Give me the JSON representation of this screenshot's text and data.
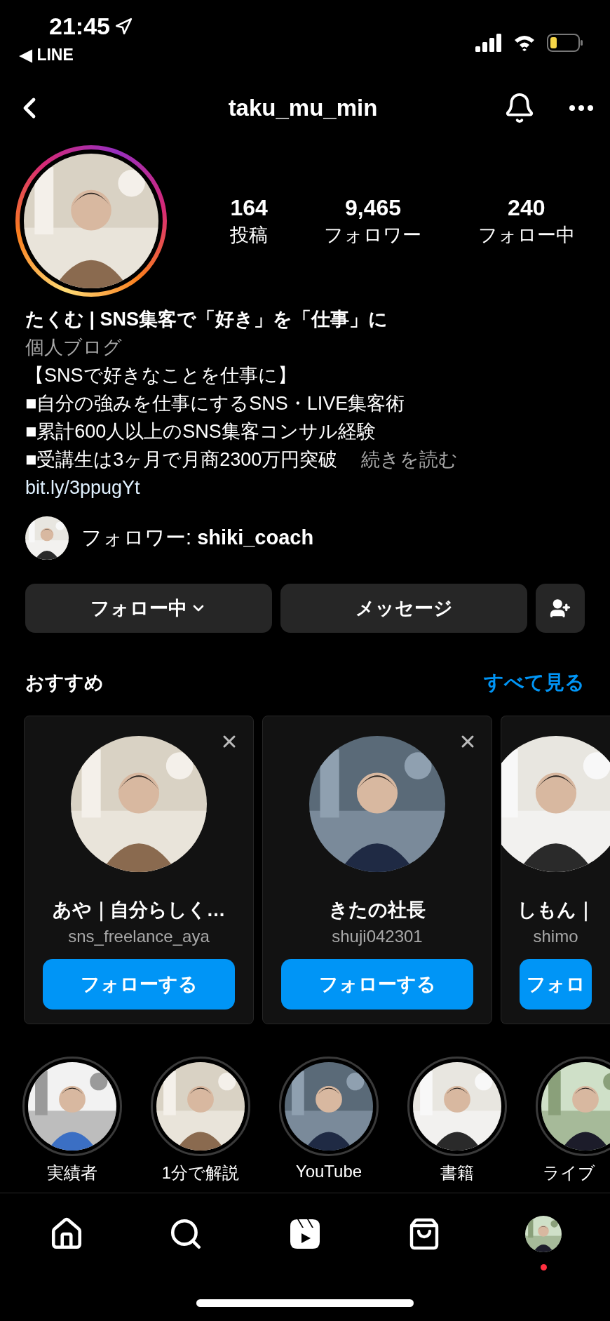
{
  "status_bar": {
    "time": "21:45",
    "back_app": "◀ LINE"
  },
  "header": {
    "username": "taku_mu_min"
  },
  "stats": [
    {
      "value": "164",
      "label": "投稿"
    },
    {
      "value": "9,465",
      "label": "フォロワー"
    },
    {
      "value": "240",
      "label": "フォロー中"
    }
  ],
  "bio": {
    "name": "たくむ | SNS集客で「好き」を「仕事」に",
    "category": "個人ブログ",
    "lines": [
      "【SNSで好きなことを仕事に】",
      "■自分の強みを仕事にするSNS・LIVE集客術",
      "■累計600人以上のSNS集客コンサル経験",
      "■受講生は3ヶ月で月商2300万円突破"
    ],
    "more": "続きを読む",
    "link": "bit.ly/3ppugYt"
  },
  "followed_by": "フォロワー: **shiki_coach**",
  "actions": {
    "following": "フォロー中",
    "message": "メッセージ"
  },
  "suggestions": {
    "title": "おすすめ",
    "see_all": "すべて見る",
    "cards": [
      {
        "name": "あや｜自分らしく…",
        "username": "sns_freelance_aya",
        "button": "フォローする",
        "dismissible": true
      },
      {
        "name": "きたの社長",
        "username": "shuji042301",
        "button": "フォローする",
        "dismissible": true
      },
      {
        "name": "しもん｜",
        "username": "shimo",
        "button": "フォロ",
        "dismissible": false
      }
    ]
  },
  "highlights": [
    {
      "label": "実績者"
    },
    {
      "label": "1分で解説"
    },
    {
      "label": "YouTube"
    },
    {
      "label": "書籍"
    },
    {
      "label": "ライブ"
    }
  ],
  "nav": [
    {
      "kind": "home"
    },
    {
      "kind": "search"
    },
    {
      "kind": "reels"
    },
    {
      "kind": "shop"
    },
    {
      "kind": "profile",
      "notification": true
    }
  ]
}
